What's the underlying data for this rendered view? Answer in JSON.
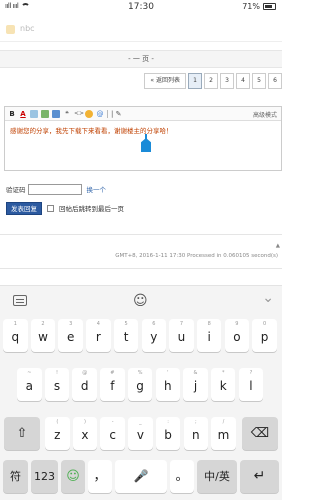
{
  "status_bar": {
    "carrier": "ııll ıııl",
    "time": "17:30",
    "battery": "71%"
  },
  "header": {
    "text": "nbc"
  },
  "page_selector": {
    "label": "- 一 页 -"
  },
  "pagination": {
    "prev": "« 返回列表",
    "pages": [
      "1",
      "2",
      "3",
      "4",
      "5",
      "6"
    ]
  },
  "editor": {
    "advanced_mode": "高级模式",
    "content": "感谢您的分享，我先下载下来看看，谢谢楼主的分享哈！",
    "toolbar_more": "| ✎"
  },
  "verify": {
    "label": "验证码",
    "refresh": "换一个"
  },
  "submit": {
    "button": "发表回复",
    "checkbox_label": "回帖后跳转到最后一页"
  },
  "footer": {
    "line": "GMT+8, 2016-1-11 17:30 Processed in 0.060105 second(s)",
    "mark": "▲"
  },
  "keyboard": {
    "row1": [
      {
        "main": "q",
        "sub": "1"
      },
      {
        "main": "w",
        "sub": "2"
      },
      {
        "main": "e",
        "sub": "3"
      },
      {
        "main": "r",
        "sub": "4"
      },
      {
        "main": "t",
        "sub": "5"
      },
      {
        "main": "y",
        "sub": "6"
      },
      {
        "main": "u",
        "sub": "7"
      },
      {
        "main": "i",
        "sub": "8"
      },
      {
        "main": "o",
        "sub": "9"
      },
      {
        "main": "p",
        "sub": "0"
      }
    ],
    "row2": [
      {
        "main": "a",
        "sub": "~"
      },
      {
        "main": "s",
        "sub": "!"
      },
      {
        "main": "d",
        "sub": "@"
      },
      {
        "main": "f",
        "sub": "#"
      },
      {
        "main": "g",
        "sub": "%"
      },
      {
        "main": "h",
        "sub": "'"
      },
      {
        "main": "j",
        "sub": "&"
      },
      {
        "main": "k",
        "sub": "*"
      },
      {
        "main": "l",
        "sub": "?"
      }
    ],
    "row3": [
      {
        "main": "z",
        "sub": "("
      },
      {
        "main": "x",
        "sub": ")"
      },
      {
        "main": "c",
        "sub": "-"
      },
      {
        "main": "v",
        "sub": "_"
      },
      {
        "main": "b",
        "sub": ":"
      },
      {
        "main": "n",
        "sub": ";"
      },
      {
        "main": "m",
        "sub": "/"
      }
    ],
    "shift": "⇧",
    "backspace": "⌫",
    "symbol": "符",
    "num": "123",
    "emoji": "☺",
    "comma": "，",
    "mic": "🎤",
    "period": "。",
    "lang": "中/英",
    "enter": "↵"
  }
}
